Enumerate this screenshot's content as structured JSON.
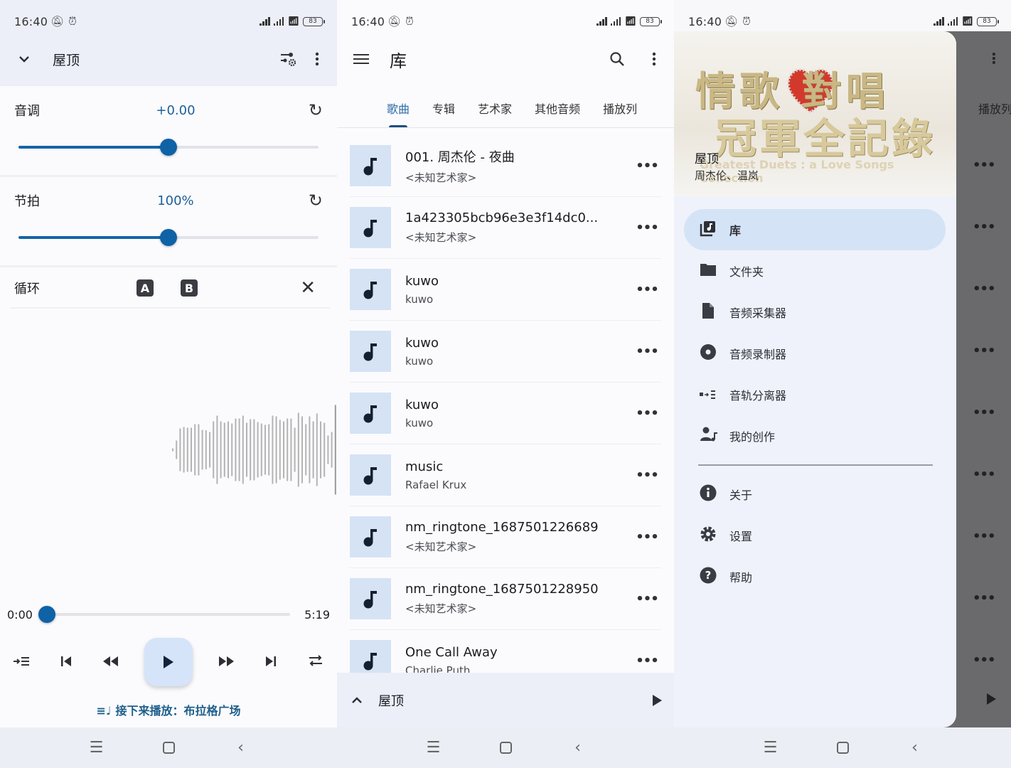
{
  "status_bar": {
    "time": "16:40",
    "battery": "83"
  },
  "player_screen": {
    "title": "屋顶",
    "pitch": {
      "label": "音调",
      "value": "+0.00",
      "level": 0.5
    },
    "tempo": {
      "label": "节拍",
      "value": "100%",
      "level": 0.5
    },
    "loop": {
      "label": "循环",
      "a_label": "A",
      "b_label": "B"
    },
    "position": {
      "current": "0:00",
      "total": "5:19",
      "fraction": 0.0
    },
    "up_next": "接下来播放：布拉格广场",
    "colors": {
      "accent": "#0e62a6",
      "play_button_bg": "#d5e4f8"
    }
  },
  "library_screen": {
    "title": "库",
    "tabs": [
      "歌曲",
      "专辑",
      "艺术家",
      "其他音频",
      "播放列"
    ],
    "active_tab": 0,
    "songs": [
      {
        "title": "001. 周杰伦 - 夜曲",
        "artist": "<未知艺术家>"
      },
      {
        "title": "1a423305bcb96e3e3f14dc0...",
        "artist": "<未知艺术家>"
      },
      {
        "title": "kuwo",
        "artist": "kuwo"
      },
      {
        "title": "kuwo",
        "artist": "kuwo"
      },
      {
        "title": "kuwo",
        "artist": "kuwo"
      },
      {
        "title": "music",
        "artist": "Rafael Krux"
      },
      {
        "title": "nm_ringtone_1687501226689",
        "artist": "<未知艺术家>"
      },
      {
        "title": "nm_ringtone_1687501228950",
        "artist": "<未知艺术家>"
      },
      {
        "title": "One Call Away",
        "artist": "Charlie Puth"
      }
    ],
    "mini_player_title": "屋顶"
  },
  "drawer_screen": {
    "cover_text_1": "情歌  對唱",
    "cover_text_2": "冠軍全記錄",
    "cover_subtitle": "Greatest Duets : a Love Songs Collection",
    "now_playing_title": "屋顶",
    "now_playing_artist": "周杰伦、温岚",
    "behind_tab": "播放列",
    "menu_items": [
      {
        "label": "库",
        "icon": "library-music-icon",
        "active": true
      },
      {
        "label": "文件夹",
        "icon": "folder-icon"
      },
      {
        "label": "音频采集器",
        "icon": "file-icon"
      },
      {
        "label": "音频录制器",
        "icon": "record-icon"
      },
      {
        "label": "音轨分离器",
        "icon": "track-separator-icon"
      },
      {
        "label": "我的创作",
        "icon": "user-music-icon"
      }
    ],
    "secondary_items": [
      {
        "label": "关于",
        "icon": "info-icon"
      },
      {
        "label": "设置",
        "icon": "gear-icon"
      },
      {
        "label": "帮助",
        "icon": "help-icon"
      }
    ]
  }
}
